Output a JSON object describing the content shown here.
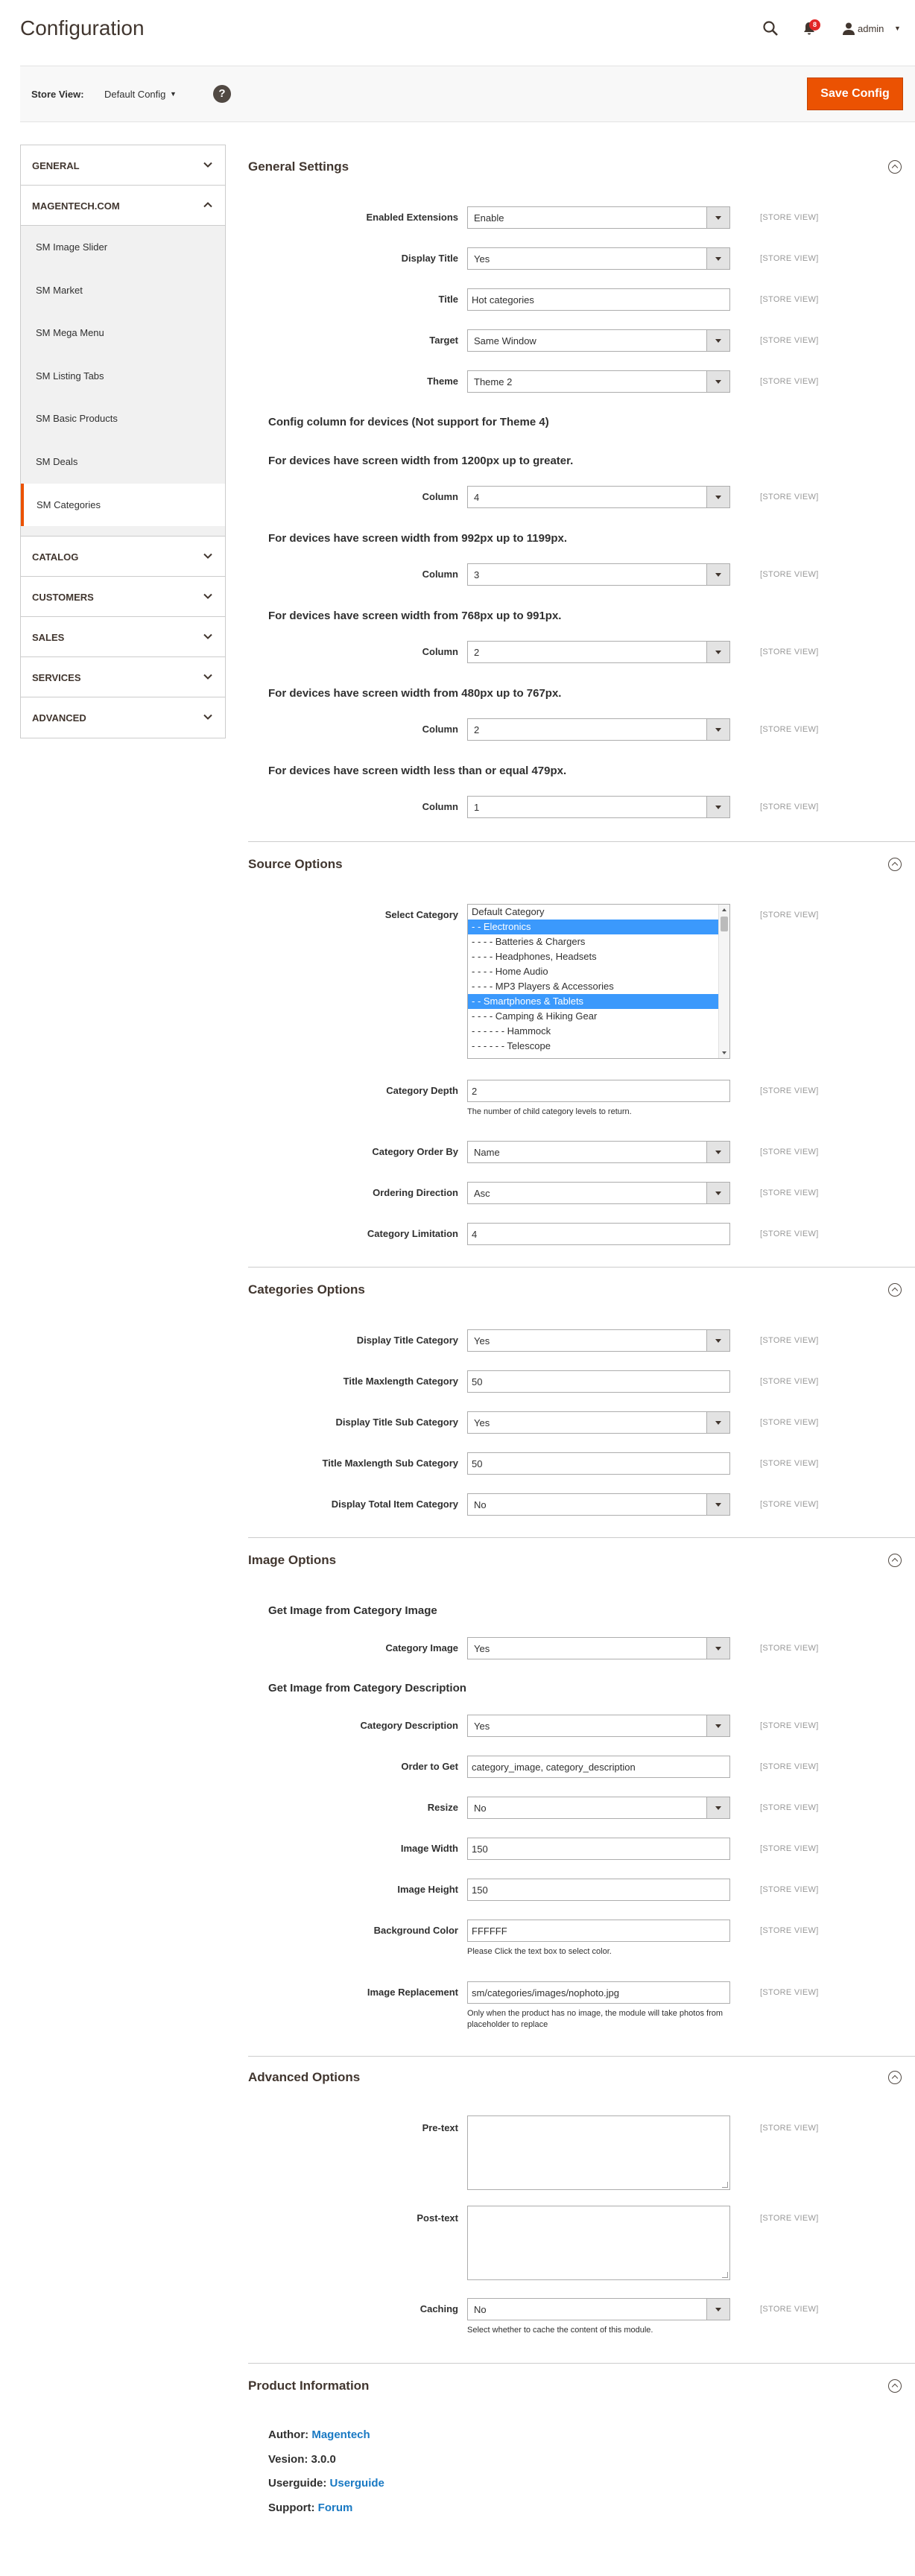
{
  "header": {
    "title": "Configuration",
    "notification_count": "8",
    "user": "admin"
  },
  "store_bar": {
    "label": "Store View:",
    "value": "Default Config",
    "save_label": "Save Config"
  },
  "sidebar": {
    "groups": [
      {
        "label": "GENERAL"
      },
      {
        "label": "MAGENTECH.COM"
      },
      {
        "label": "CATALOG"
      },
      {
        "label": "CUSTOMERS"
      },
      {
        "label": "SALES"
      },
      {
        "label": "SERVICES"
      },
      {
        "label": "ADVANCED"
      }
    ],
    "magentech_items": [
      {
        "label": "SM Image Slider"
      },
      {
        "label": "SM Market"
      },
      {
        "label": "SM Mega Menu"
      },
      {
        "label": "SM Listing Tabs"
      },
      {
        "label": "SM Basic Products"
      },
      {
        "label": "SM Deals"
      },
      {
        "label": "SM Categories"
      }
    ]
  },
  "scope_label": "[STORE VIEW]",
  "general": {
    "title": "General Settings",
    "enabled_label": "Enabled Extensions",
    "enabled_value": "Enable",
    "display_title_label": "Display Title",
    "display_title_value": "Yes",
    "title_label": "Title",
    "title_value": "Hot categories",
    "target_label": "Target",
    "target_value": "Same Window",
    "theme_label": "Theme",
    "theme_value": "Theme 2",
    "config_heading": "Config column for devices (Not support for Theme 4)",
    "column_label": "Column",
    "devices": [
      {
        "heading": "For devices have screen width from 1200px up to greater.",
        "value": "4"
      },
      {
        "heading": "For devices have screen width from 992px up to 1199px.",
        "value": "3"
      },
      {
        "heading": "For devices have screen width from 768px up to 991px.",
        "value": "2"
      },
      {
        "heading": "For devices have screen width from 480px up to 767px.",
        "value": "2"
      },
      {
        "heading": "For devices have screen width less than or equal 479px.",
        "value": "1"
      }
    ]
  },
  "source": {
    "title": "Source Options",
    "select_category_label": "Select Category",
    "categories": [
      "Default Category",
      "- - Electronics",
      "- - - - Batteries & Chargers",
      "- - - - Headphones, Headsets",
      "- - - - Home Audio",
      "- - - - MP3 Players & Accessories",
      "- - Smartphones & Tablets",
      "- - - - Camping & Hiking Gear",
      "- - - - - - Hammock",
      "- - - - - - Telescope"
    ],
    "depth_label": "Category Depth",
    "depth_value": "2",
    "depth_note": "The number of child category levels to return.",
    "order_by_label": "Category Order By",
    "order_by_value": "Name",
    "direction_label": "Ordering Direction",
    "direction_value": "Asc",
    "limit_label": "Category Limitation",
    "limit_value": "4"
  },
  "categories_opts": {
    "title": "Categories Options",
    "display_title_label": "Display Title Category",
    "display_title_value": "Yes",
    "title_max_label": "Title Maxlength Category",
    "title_max_value": "50",
    "display_sub_label": "Display Title Sub Category",
    "display_sub_value": "Yes",
    "sub_max_label": "Title Maxlength Sub Category",
    "sub_max_value": "50",
    "total_label": "Display Total Item Category",
    "total_value": "No"
  },
  "image": {
    "title": "Image Options",
    "from_image_heading": "Get Image from Category Image",
    "cat_image_label": "Category Image",
    "cat_image_value": "Yes",
    "from_desc_heading": "Get Image from Category Description",
    "cat_desc_label": "Category Description",
    "cat_desc_value": "Yes",
    "order_label": "Order to Get",
    "order_value": "category_image, category_description",
    "resize_label": "Resize",
    "resize_value": "No",
    "width_label": "Image Width",
    "width_value": "150",
    "height_label": "Image Height",
    "height_value": "150",
    "bg_label": "Background Color",
    "bg_value": "FFFFFF",
    "bg_note": "Please Click the text box to select color.",
    "repl_label": "Image Replacement",
    "repl_value": "sm/categories/images/nophoto.jpg",
    "repl_note": "Only when the product has no image, the module will take photos from placeholder to replace"
  },
  "advanced": {
    "title": "Advanced Options",
    "pre_label": "Pre-text",
    "post_label": "Post-text",
    "caching_label": "Caching",
    "caching_value": "No",
    "caching_note": "Select whether to cache the content of this module."
  },
  "product": {
    "title": "Product Information",
    "author_label": "Author:",
    "author_value": "Magentech",
    "version_label": "Vesion:",
    "version_value": "3.0.0",
    "guide_label": "Userguide:",
    "guide_value": "Userguide",
    "support_label": "Support:",
    "support_value": "Forum"
  }
}
